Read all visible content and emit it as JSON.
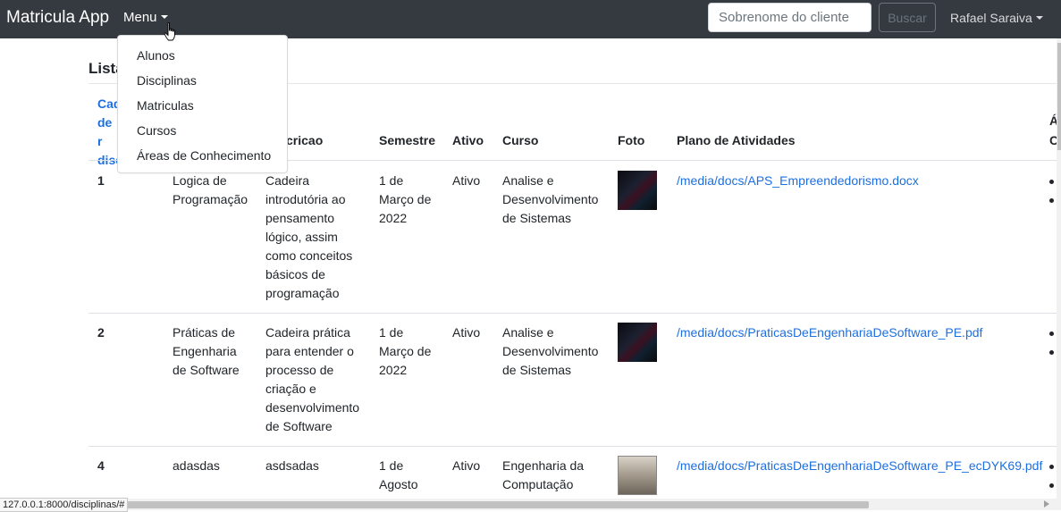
{
  "navbar": {
    "brand": "Matricula App",
    "menu_label": "Menu",
    "search_placeholder": "Sobrenome do cliente",
    "search_button": "Buscar",
    "user_name": "Rafael Saraiva"
  },
  "dropdown": {
    "items": [
      "Alunos",
      "Disciplinas",
      "Matriculas",
      "Cursos",
      "Áreas de Conhecimento"
    ]
  },
  "main": {
    "title": "Lista",
    "add_link": "Cad\nde r\ndisc",
    "columns": [
      "cricao",
      "Semestre",
      "Ativo",
      "Curso",
      "Foto",
      "Plano de Atividades"
    ],
    "partial_column_top": "Á",
    "partial_column_bottom": "C",
    "rows": [
      {
        "id": "1",
        "nome": "Logica de\nProgramação",
        "descricao": "Cadeira\nintrodutória ao\npensamento\nlógico, assim\ncomo conceitos\nbásicos de\nprogramação",
        "semestre": "1 de\nMarço de\n2022",
        "ativo": "Ativo",
        "curso": "Analise e\nDesenvolvimento\nde Sistemas",
        "foto": "dark-photo",
        "plano": "/media/docs/APS_Empreendedorismo.docx"
      },
      {
        "id": "2",
        "nome": "Práticas de\nEngenharia\nde Software",
        "descricao": "Cadeira prática\npara entender o\nprocesso de\ncriação e\ndesenvolvimento\nde Software",
        "semestre": "1 de\nMarço de\n2022",
        "ativo": "Ativo",
        "curso": "Analise e\nDesenvolvimento\nde Sistemas",
        "foto": "dark-photo",
        "plano": "/media/docs/PraticasDeEngenhariaDeSoftware_PE.pdf"
      },
      {
        "id": "4",
        "nome": "adasdas",
        "descricao": "asdsadas",
        "semestre": "1 de\nAgosto",
        "ativo": "Ativo",
        "curso": "Engenharia da\nComputação",
        "foto": "light-photo",
        "plano": "/media/docs/PraticasDeEngenhariaDeSoftware_PE_ecDYK69.pdf"
      }
    ]
  },
  "status_bar": {
    "url": "127.0.0.1:8000/disciplinas/#"
  }
}
